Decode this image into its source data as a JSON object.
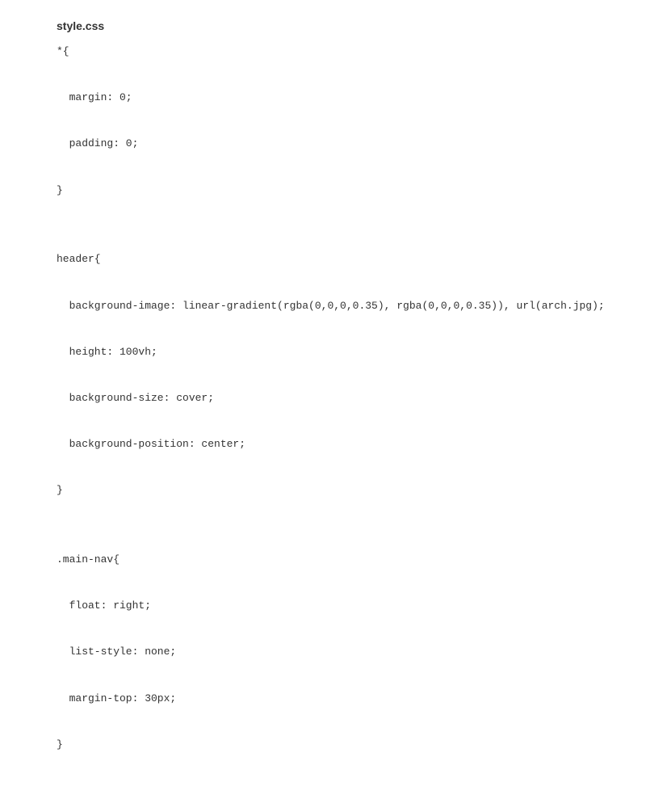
{
  "filename": "style.css",
  "code": {
    "l1": "*{",
    "l2": "margin: 0;",
    "l3": "padding: 0;",
    "l4": "}",
    "l5": "",
    "l6": "header{",
    "l7": "background-image: linear-gradient(rgba(0,0,0,0.35), rgba(0,0,0,0.35)), url(arch.jpg);",
    "l8": "height: 100vh;",
    "l9": "background-size: cover;",
    "l10": "background-position: center;",
    "l11": "}",
    "l12": "",
    "l13": ".main-nav{",
    "l14": "float: right;",
    "l15": "list-style: none;",
    "l16": "margin-top: 30px;",
    "l17": "}"
  }
}
